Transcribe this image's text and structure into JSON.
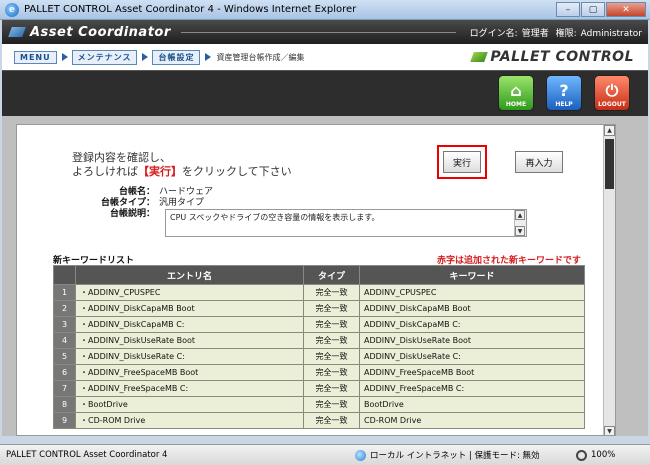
{
  "window": {
    "title": "PALLET CONTROL Asset Coordinator 4 - Windows Internet Explorer",
    "min": "–",
    "max": "▢",
    "close": "✕"
  },
  "header": {
    "app_name": "Asset Coordinator",
    "login_label": "ログイン名:",
    "login_value": "管理者",
    "role_label": "権限:",
    "role_value": "Administrator"
  },
  "breadcrumb": {
    "items": [
      "MENU",
      "メンテナンス",
      "台帳設定"
    ],
    "current": "資産管理台帳作成／編集"
  },
  "brand": "PALLET CONTROL",
  "toolbar": {
    "home": "HOME",
    "help": "HELP",
    "logout": "LOGOUT"
  },
  "confirm": {
    "line1": "登録内容を確認し、",
    "line2_pre": "よろしければ",
    "line2_hl": "【実行】",
    "line2_post": "をクリックして下さい"
  },
  "buttons": {
    "execute": "実行",
    "reenter": "再入力"
  },
  "ledger": {
    "name_label": "台帳名：",
    "name_value": "ハードウェア",
    "type_label": "台帳タイプ：",
    "type_value": "汎用タイプ",
    "desc_label": "台帳説明：",
    "desc_value": "CPU スペックやドライブの空き容量の情報を表示します。"
  },
  "keyword_list": {
    "title": "新キーワードリスト",
    "note": "赤字は追加された新キーワードです",
    "columns": [
      "",
      "エントリ名",
      "タイプ",
      "キーワード"
    ],
    "rows": [
      {
        "no": "1",
        "entry": "・ADDINV_CPUSPEC",
        "type": "完全一致",
        "keyword": "ADDINV_CPUSPEC"
      },
      {
        "no": "2",
        "entry": "・ADDINV_DiskCapaMB Boot",
        "type": "完全一致",
        "keyword": "ADDINV_DiskCapaMB Boot"
      },
      {
        "no": "3",
        "entry": "・ADDINV_DiskCapaMB C:",
        "type": "完全一致",
        "keyword": "ADDINV_DiskCapaMB C:"
      },
      {
        "no": "4",
        "entry": "・ADDINV_DiskUseRate Boot",
        "type": "完全一致",
        "keyword": "ADDINV_DiskUseRate Boot"
      },
      {
        "no": "5",
        "entry": "・ADDINV_DiskUseRate C:",
        "type": "完全一致",
        "keyword": "ADDINV_DiskUseRate C:"
      },
      {
        "no": "6",
        "entry": "・ADDINV_FreeSpaceMB Boot",
        "type": "完全一致",
        "keyword": "ADDINV_FreeSpaceMB Boot"
      },
      {
        "no": "7",
        "entry": "・ADDINV_FreeSpaceMB C:",
        "type": "完全一致",
        "keyword": "ADDINV_FreeSpaceMB C:"
      },
      {
        "no": "8",
        "entry": "・BootDrive",
        "type": "完全一致",
        "keyword": "BootDrive"
      },
      {
        "no": "9",
        "entry": "・CD-ROM Drive",
        "type": "完全一致",
        "keyword": "CD-ROM Drive"
      }
    ]
  },
  "status": {
    "left": "PALLET CONTROL Asset Coordinator 4",
    "zone": "ローカル イントラネット | 保護モード: 無効",
    "zoom": "100%"
  }
}
